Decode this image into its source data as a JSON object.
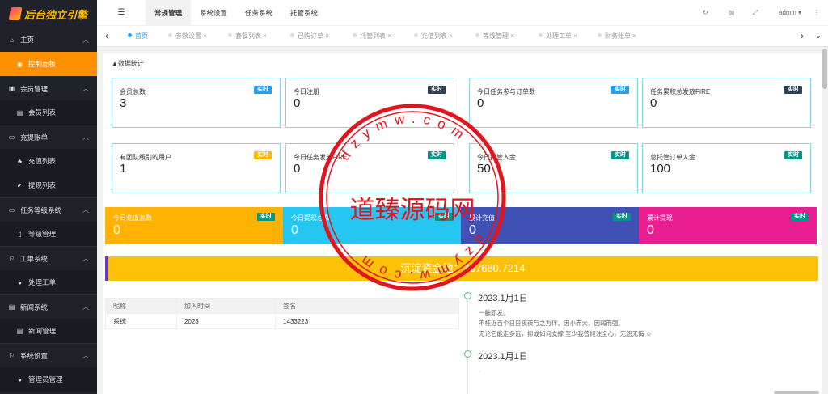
{
  "brand": {
    "name": "后台独立引擎"
  },
  "sidebar": {
    "home": {
      "icon": "home-icon",
      "label": "主页"
    },
    "dashboard": {
      "icon": "dashboard-icon",
      "label": "控制面板"
    },
    "groups": [
      {
        "icon": "member-icon",
        "label": "会员管理",
        "sub": {
          "icon": "list-icon",
          "label": "会员列表"
        }
      },
      {
        "icon": "card-icon",
        "label": "充提账单",
        "sub": [
          {
            "icon": "cart-icon",
            "label": "充值列表"
          },
          {
            "icon": "check-icon",
            "label": "提现列表"
          }
        ]
      },
      {
        "icon": "monitor-icon",
        "label": "任务等级系统",
        "sub": {
          "icon": "box-icon",
          "label": "等级管理"
        }
      },
      {
        "icon": "flag-icon",
        "label": "工单系统",
        "sub": {
          "icon": "circle-icon",
          "label": "处理工单"
        }
      },
      {
        "icon": "news-icon",
        "label": "新闻系统",
        "sub": {
          "icon": "news-list-icon",
          "label": "新闻管理"
        }
      },
      {
        "icon": "flag-icon",
        "label": "系统设置",
        "sub": {
          "icon": "circle-icon",
          "label": "管理员管理"
        }
      }
    ]
  },
  "header": {
    "nav": [
      "常规管理",
      "系统设置",
      "任务系统",
      "托管系统"
    ],
    "user": "admin"
  },
  "tabs": [
    "首页",
    "参数设置",
    "套餐列表",
    "已购订单",
    "托管列表",
    "充值列表",
    "等级管理",
    "处理工单",
    "财务账单"
  ],
  "page": {
    "title": "数据统计",
    "badge": "实时",
    "cards": [
      {
        "title": "会员总数",
        "value": "3",
        "badge_color": "#1e9fff"
      },
      {
        "title": "今日注册",
        "value": "0",
        "badge_color": "#2f4056"
      },
      {
        "title": "今日任务参与订单数",
        "value": "0",
        "badge_color": "#1e9fff"
      },
      {
        "title": "任务累积总发放FIRE",
        "value": "0",
        "badge_color": "#2f4056"
      },
      {
        "title": "有团队级别的用户",
        "value": "1",
        "badge_color": "#ffb800"
      },
      {
        "title": "今日任务发放FIRE",
        "value": "0",
        "badge_color": "#009688"
      },
      {
        "title": "今日托管入金",
        "value": "50",
        "badge_color": "#009688"
      },
      {
        "title": "总托管订单入金",
        "value": "100",
        "badge_color": "#009688"
      }
    ],
    "colored": [
      {
        "title": "今日充值总数",
        "value": "0",
        "bg": "#ffb300"
      },
      {
        "title": "今日提现总数",
        "value": "0",
        "bg": "#26c6f2"
      },
      {
        "title": "累计充值",
        "value": "0",
        "bg": "#3f51b5"
      },
      {
        "title": "累计提现",
        "value": "0",
        "bg": "#e91e90"
      }
    ],
    "pool_text": "沉淀资金池：437680.7214",
    "table": {
      "headers": [
        "昵称",
        "加入时间",
        "签名"
      ],
      "rows": [
        [
          "系统",
          "2023",
          "1433223"
        ]
      ]
    },
    "timeline": [
      {
        "date": "2023.1月1日",
        "lines": [
          "一触即发。",
          "不枉近百个日日夜夜与之为伴。因小而大，因弱而强。",
          "无论它能走多远，抑或如何支撑 至少我曾倾注全心，无怨无悔 ☺"
        ]
      },
      {
        "date": "2023.1月1日",
        "lines": [
          "",
          "",
          "·"
        ]
      }
    ]
  },
  "watermark": {
    "center_text": "道臻源码网",
    "ring_text": "dzymw.com",
    "color": "#e0151d"
  }
}
